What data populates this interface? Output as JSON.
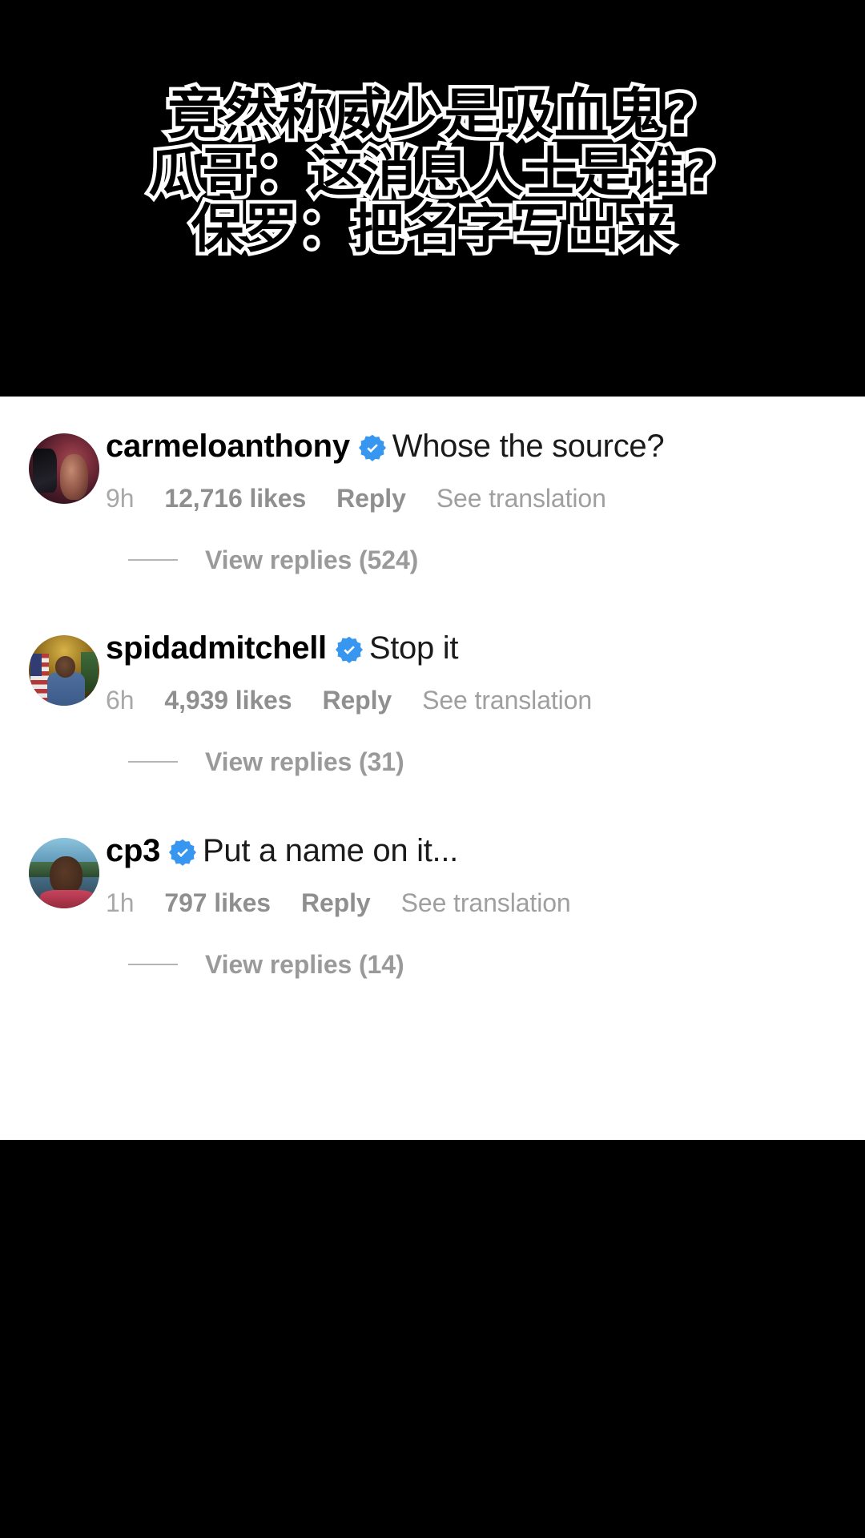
{
  "overlay_title": {
    "line1": "竟然称威少是吸血鬼?",
    "line2": "瓜哥：这消息人士是谁?",
    "line3": "保罗：把名字写出来"
  },
  "colors": {
    "background": "#000000",
    "panel": "#ffffff",
    "verified_blue": "#3797F0",
    "meta_gray": "#9a9a9a",
    "text_black": "#161616"
  },
  "comments": [
    {
      "username": "carmeloanthony",
      "verified": true,
      "verified_icon": "verified-badge-icon",
      "text": "Whose the source?",
      "time": "9h",
      "likes": "12,716 likes",
      "reply": "Reply",
      "translate": "See translation",
      "view_replies": "View replies (524)",
      "avatar_name": "avatar-carmeloanthony"
    },
    {
      "username": "spidadmitchell",
      "verified": true,
      "verified_icon": "verified-badge-icon",
      "text": "Stop it",
      "time": "6h",
      "likes": "4,939 likes",
      "reply": "Reply",
      "translate": "See translation",
      "view_replies": "View replies (31)",
      "avatar_name": "avatar-spidadmitchell"
    },
    {
      "username": "cp3",
      "verified": true,
      "verified_icon": "verified-badge-icon",
      "text": "Put a name on it...",
      "time": "1h",
      "likes": "797 likes",
      "reply": "Reply",
      "translate": "See translation",
      "view_replies": "View replies (14)",
      "avatar_name": "avatar-cp3"
    }
  ]
}
